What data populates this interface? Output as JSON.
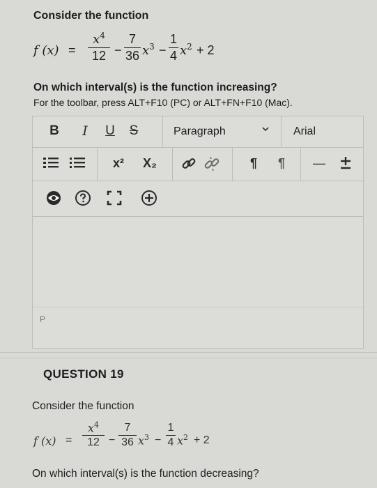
{
  "question18": {
    "heading": "Consider the function",
    "fn_name": "f (x)",
    "eq": "=",
    "t1_num": "x",
    "t1_exp": "4",
    "t1_den": "12",
    "minus1": "−",
    "t2_num": "7",
    "t2_den": "36",
    "t2_var": "x",
    "t2_exp": "3",
    "minus2": "−",
    "t3_num": "1",
    "t3_den": "4",
    "t3_var": "x",
    "t3_exp": "2",
    "tail": "+ 2",
    "prompt": "On which interval(s) is the function increasing?"
  },
  "editor": {
    "instructions": "For the toolbar, press ALT+F10 (PC) or ALT+FN+F10 (Mac).",
    "bold": "B",
    "italic": "I",
    "underline": "U",
    "strike": "S",
    "paragraph_select": "Paragraph",
    "font_select": "Arial",
    "superscript": "x²",
    "subscript": "X₂",
    "ltr": "¶",
    "rtl": "¶",
    "hr": "—",
    "status_path": "P",
    "icons": [
      "bullet-list-icon",
      "numbered-list-icon",
      "link-icon",
      "unlink-icon",
      "preview-icon",
      "help-icon",
      "fullscreen-icon",
      "add-content-icon",
      "plus-minus-icon"
    ]
  },
  "question19": {
    "label": "QUESTION 19",
    "heading": "Consider the function",
    "fn_name": "f (x)",
    "eq": "=",
    "t1_num": "x",
    "t1_exp": "4",
    "t1_den": "12",
    "minus1": "−",
    "t2_num": "7",
    "t2_den": "36",
    "t2_var": "x",
    "t2_exp": "3",
    "minus2": "−",
    "t3_num": "1",
    "t3_den": "4",
    "t3_var": "x",
    "t3_exp": "2",
    "tail": "+ 2",
    "prompt": "On which interval(s) is the function decreasing?"
  }
}
